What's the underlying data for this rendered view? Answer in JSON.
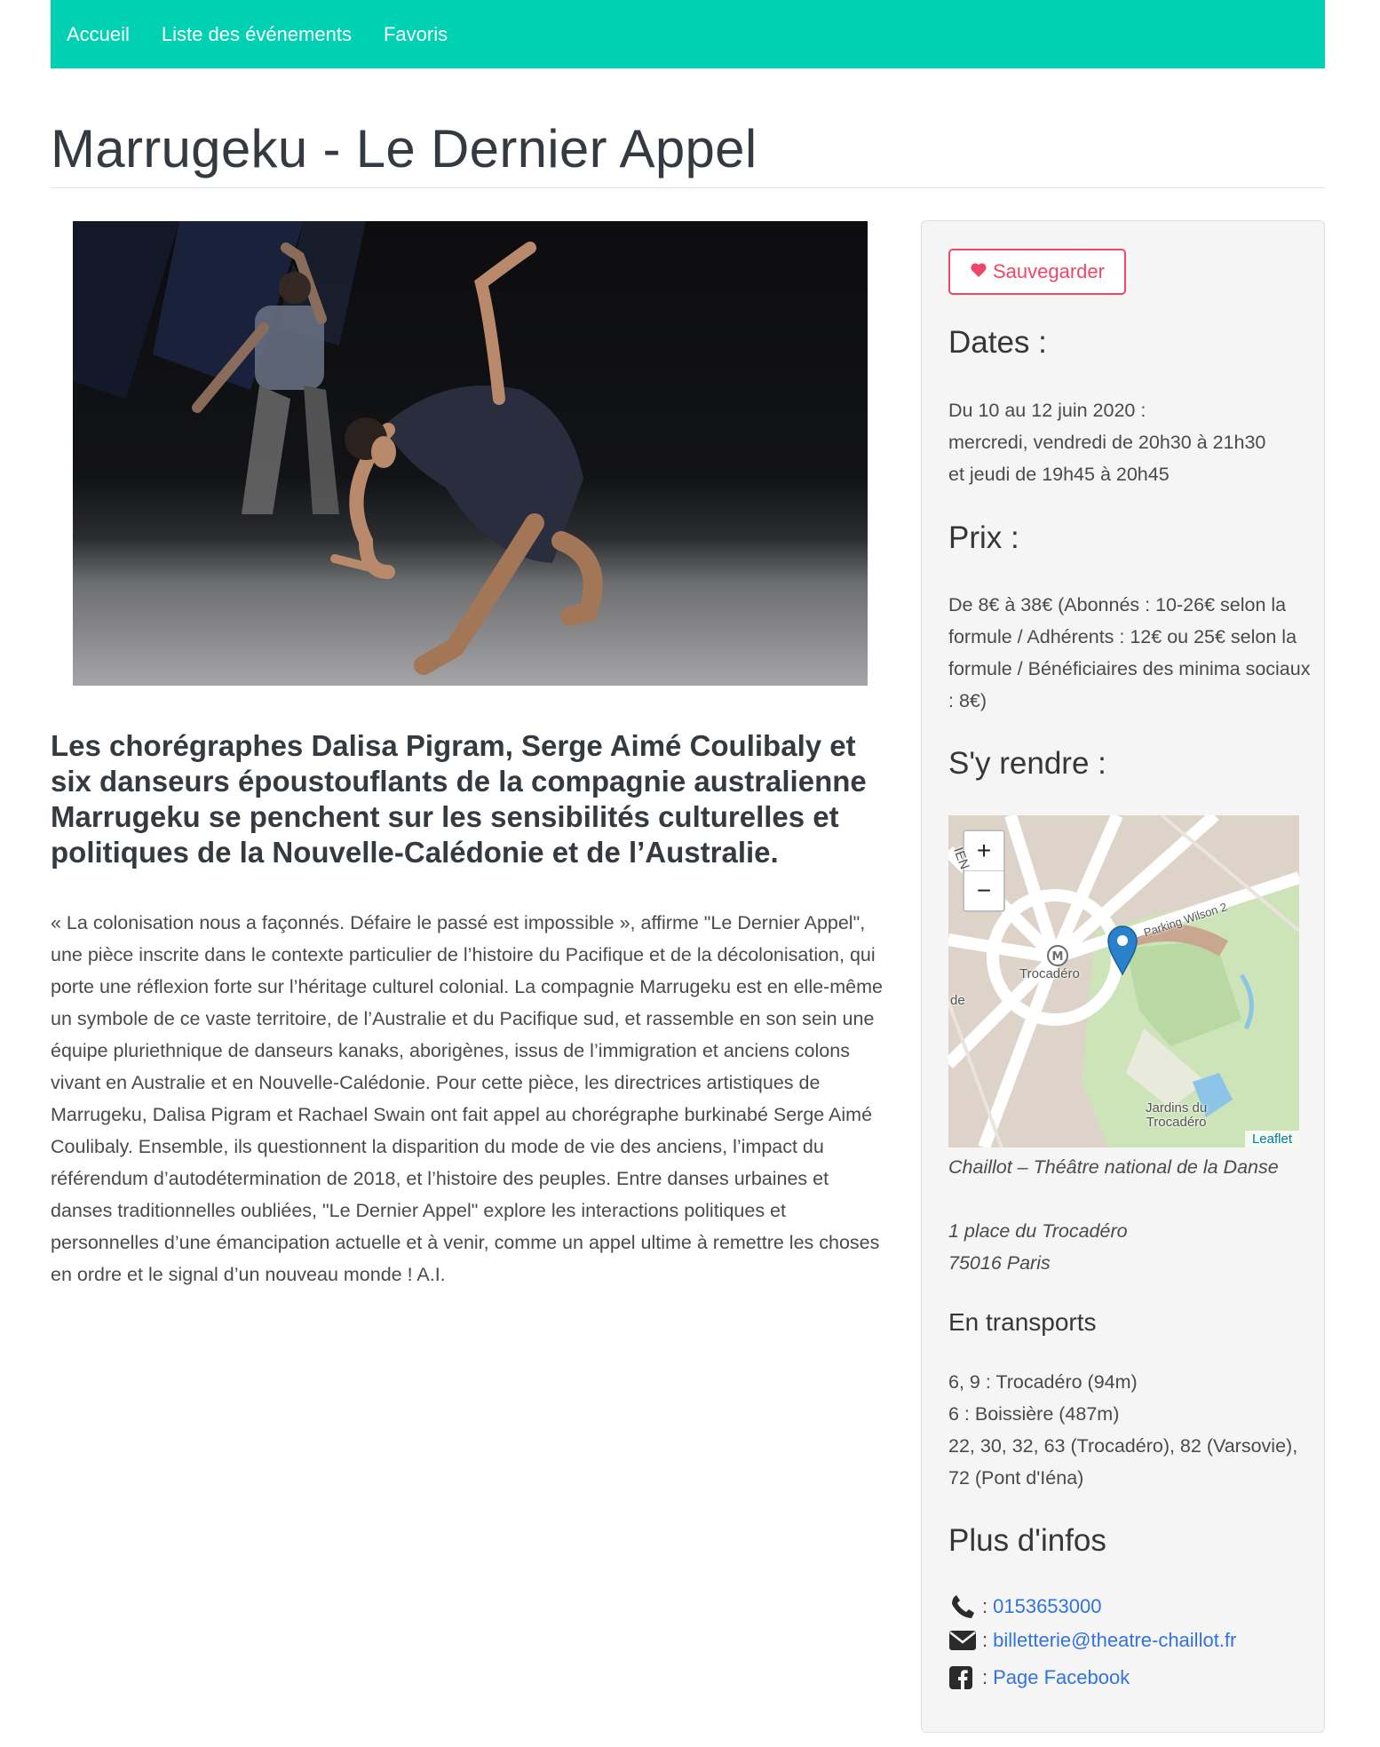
{
  "nav": {
    "items": [
      {
        "label": "Accueil"
      },
      {
        "label": "Liste des événements"
      },
      {
        "label": "Favoris"
      }
    ]
  },
  "event": {
    "title": "Marrugeku - Le Dernier Appel",
    "lead": "Les chorégraphes Dalisa Pigram, Serge Aimé Coulibaly et six danseurs époustouflants de la compagnie australienne Marrugeku se penchent sur les sensibilités culturelles et politiques de la Nouvelle-Calédonie et de l’Australie.",
    "description": "« La colonisation nous a façonnés. Défaire le passé est impossible », affirme \"Le Dernier Appel\", une pièce inscrite dans le contexte particulier de l’histoire du Pacifique et de la décolonisation, qui porte une réflexion forte sur l’héritage culturel colonial. La compagnie Marrugeku est en elle-même un symbole de ce vaste territoire, de l’Australie et du Pacifique sud, et rassemble en son sein une équipe pluriethnique de danseurs kanaks, aborigènes, issus de l’immigration et anciens colons vivant en Australie et en Nouvelle-Calédonie. Pour cette pièce, les directrices artistiques de Marrugeku, Dalisa Pigram et Rachael Swain ont fait appel au chorégraphe burkinabé Serge Aimé Coulibaly. Ensemble, ils questionnent la disparition du mode de vie des anciens, l’impact du référendum d’autodétermination de 2018, et l’histoire des peuples. Entre danses urbaines et danses traditionnelles oubliées, \"Le Dernier Appel\" explore les interactions politiques et personnelles d’une émancipation actuelle et à venir, comme un appel ultime à remettre les choses en ordre et le signal d’un nouveau monde ! A.I."
  },
  "sidebar": {
    "save_label": "Sauvegarder",
    "dates_heading": "Dates :",
    "dates_line1": "Du 10 au 12 juin 2020 :",
    "dates_line2": "mercredi, vendredi de 20h30 à 21h30",
    "dates_line3": "et jeudi de 19h45 à 20h45",
    "price_heading": "Prix :",
    "price_text": "De 8€ à 38€ (Abonnés : 10-26€ selon la formule / Adhérents : 12€ ou 25€ selon la formule / Bénéficiaires des minima sociaux : 8€)",
    "access_heading": "S'y rendre :",
    "map": {
      "zoom_in": "+",
      "zoom_out": "−",
      "attribution": "Leaflet",
      "label_station": "Trocadéro",
      "label_street": "Parking Wilson 2",
      "label_garden_1": "Jardins du",
      "label_garden_2": "Trocadéro",
      "label_left": "de",
      "label_avenue": "IEN"
    },
    "venue_name": "Chaillot – Théâtre national de la Danse",
    "venue_address": "1 place du Trocadéro",
    "venue_city": "75016 Paris",
    "transport_heading": "En transports",
    "transport_line1": "6, 9 : Trocadéro (94m)",
    "transport_line2": "6 : Boissière (487m)",
    "transport_line3": "22, 30, 32, 63 (Trocadéro), 82 (Varsovie), 72 (Pont d'Iéna)",
    "info_heading": "Plus d'infos",
    "phone": "0153653000",
    "email": "billetterie@theatre-chaillot.fr",
    "facebook": "Page Facebook",
    "separator": ":"
  },
  "colors": {
    "navbar": "#00d1b2",
    "save": "#f14668",
    "link": "#3273dc"
  },
  "icons": [
    "heart-icon",
    "phone-icon",
    "envelope-icon",
    "facebook-icon",
    "map-marker-icon",
    "metro-icon"
  ]
}
